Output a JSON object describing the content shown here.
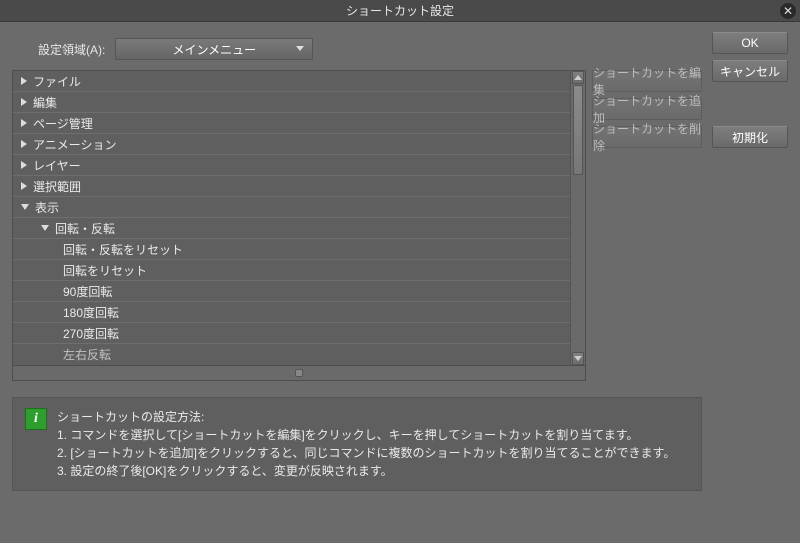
{
  "dialog": {
    "title": "ショートカット設定"
  },
  "toolbar": {
    "area_label": "設定領域(A):",
    "area_value": "メインメニュー"
  },
  "buttons": {
    "ok": "OK",
    "cancel": "キャンセル",
    "init": "初期化",
    "edit": "ショートカットを編集",
    "add": "ショートカットを追加",
    "delete": "ショートカットを削除"
  },
  "tree": {
    "items": [
      {
        "label": "ファイル",
        "expanded": false,
        "level": 0
      },
      {
        "label": "編集",
        "expanded": false,
        "level": 0
      },
      {
        "label": "ページ管理",
        "expanded": false,
        "level": 0
      },
      {
        "label": "アニメーション",
        "expanded": false,
        "level": 0
      },
      {
        "label": "レイヤー",
        "expanded": false,
        "level": 0
      },
      {
        "label": "選択範囲",
        "expanded": false,
        "level": 0
      },
      {
        "label": "表示",
        "expanded": true,
        "level": 0
      },
      {
        "label": "回転・反転",
        "expanded": true,
        "level": 1
      },
      {
        "label": "回転・反転をリセット",
        "expanded": null,
        "level": 2
      },
      {
        "label": "回転をリセット",
        "expanded": null,
        "level": 2
      },
      {
        "label": "90度回転",
        "expanded": null,
        "level": 2
      },
      {
        "label": "180度回転",
        "expanded": null,
        "level": 2
      },
      {
        "label": "270度回転",
        "expanded": null,
        "level": 2
      },
      {
        "label": "左右反転",
        "expanded": null,
        "level": 2
      }
    ]
  },
  "info": {
    "heading": "ショートカットの設定方法:",
    "line1": "1. コマンドを選択して[ショートカットを編集]をクリックし、キーを押してショートカットを割り当てます。",
    "line2": "2. [ショートカットを追加]をクリックすると、同じコマンドに複数のショートカットを割り当てることができます。",
    "line3": "3. 設定の終了後[OK]をクリックすると、変更が反映されます。"
  }
}
